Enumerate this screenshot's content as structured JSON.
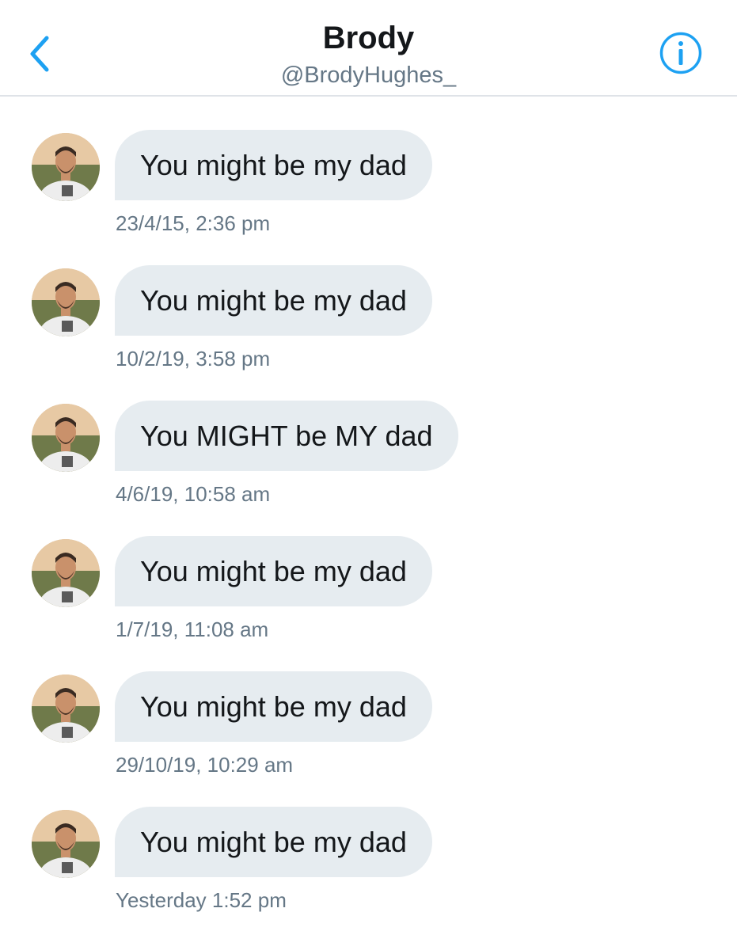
{
  "header": {
    "title": "Brody",
    "handle": "@BrodyHughes_",
    "back_icon": "chevron-left-icon",
    "info_icon": "info-icon",
    "accent_color": "#1da1f2"
  },
  "messages": [
    {
      "text": "You might be my dad",
      "time": "23/4/15, 2:36 pm"
    },
    {
      "text": "You might be my dad",
      "time": "10/2/19, 3:58 pm"
    },
    {
      "text": "You MIGHT be MY dad",
      "time": "4/6/19, 10:58 am"
    },
    {
      "text": "You might be my dad",
      "time": "1/7/19, 11:08 am"
    },
    {
      "text": "You might be my dad",
      "time": "29/10/19, 10:29 am"
    },
    {
      "text": "You might be my dad",
      "time": "Yesterday 1:52 pm"
    }
  ],
  "colors": {
    "bubble": "#e6ecf0",
    "timestamp": "#657786",
    "text": "#14171a"
  }
}
